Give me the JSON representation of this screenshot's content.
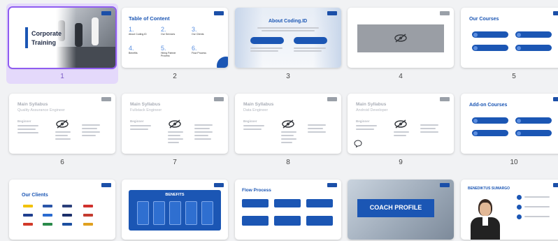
{
  "slides": [
    {
      "number": "1",
      "title_line1": "Corporate",
      "title_line2": "Training"
    },
    {
      "number": "2",
      "title": "Table of Content",
      "items": [
        {
          "num": "1.",
          "label": "About Coding.ID"
        },
        {
          "num": "2.",
          "label": "Our Services"
        },
        {
          "num": "3.",
          "label": "Our Clients"
        },
        {
          "num": "4.",
          "label": "Benefits"
        },
        {
          "num": "5.",
          "label": "Hiring Partner Process"
        },
        {
          "num": "6.",
          "label": "Flow Process"
        }
      ]
    },
    {
      "number": "3",
      "title": "About Coding.ID"
    },
    {
      "number": "4"
    },
    {
      "number": "5",
      "title": "Our Courses"
    },
    {
      "number": "6",
      "title": "Main Syllabus",
      "subtitle": "Quality Assurance Engineer",
      "section": "Beginner"
    },
    {
      "number": "7",
      "title": "Main Syllabus",
      "subtitle": "Fullstack Engineer",
      "section": "Beginner"
    },
    {
      "number": "8",
      "title": "Main Syllabus",
      "subtitle": "Data Engineer",
      "section": "Beginner"
    },
    {
      "number": "9",
      "title": "Main Syllabus",
      "subtitle": "Android Developer",
      "section": "Beginner"
    },
    {
      "number": "10",
      "title": "Add-on Courses"
    },
    {
      "number": "",
      "title": "Our Clients"
    },
    {
      "number": "",
      "title": "BENEFITS"
    },
    {
      "number": "",
      "title": "Flow Process"
    },
    {
      "number": "",
      "title": "COACH PROFILE"
    },
    {
      "number": "",
      "title": "BENEDIKTUS SUMARGO"
    }
  ],
  "colors": {
    "accent": "#1b56b4",
    "selection": "#8f5cf0",
    "selection_bg": "#e4d9fb",
    "grey_title": "#a9adb6"
  }
}
